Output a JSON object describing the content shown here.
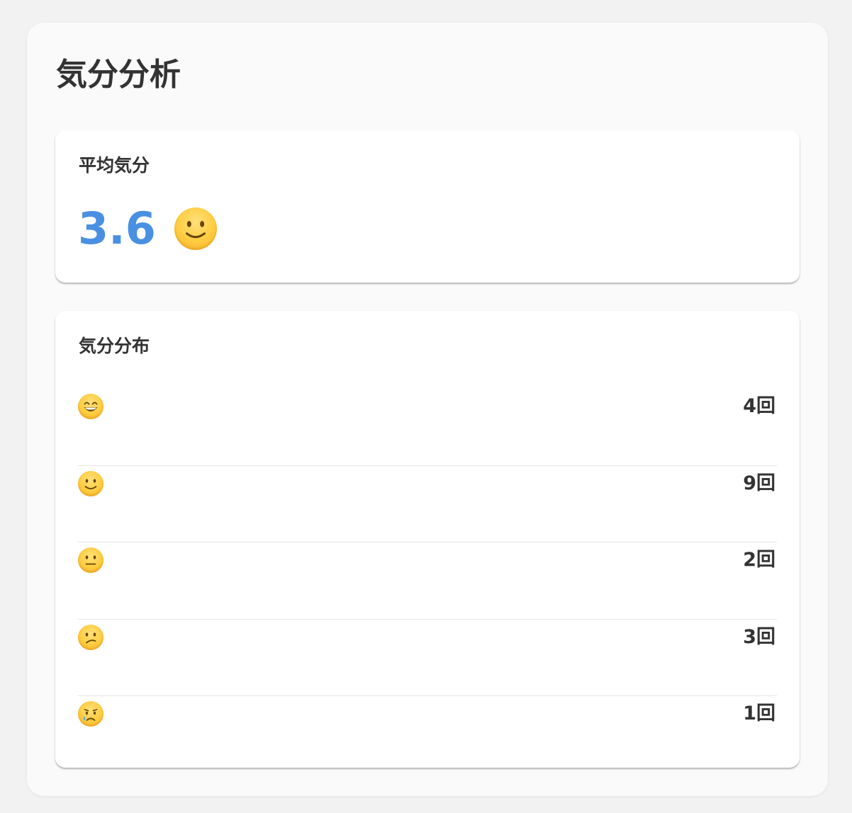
{
  "page": {
    "title": "気分分析"
  },
  "average": {
    "label": "平均気分",
    "value": "3.6",
    "icon": "slightly-smiling-face-icon"
  },
  "distribution": {
    "label": "気分分布",
    "rows": [
      {
        "icon": "grinning-face-icon",
        "count": "4回"
      },
      {
        "icon": "slightly-smiling-face-icon",
        "count": "9回"
      },
      {
        "icon": "neutral-face-icon",
        "count": "2回"
      },
      {
        "icon": "confused-face-icon",
        "count": "3回"
      },
      {
        "icon": "crying-face-icon",
        "count": "1回"
      }
    ]
  },
  "colors": {
    "accent": "#4a90e2",
    "text": "#333333",
    "card": "#ffffff",
    "panel": "#fafafa",
    "divider": "#e6e6e6"
  }
}
